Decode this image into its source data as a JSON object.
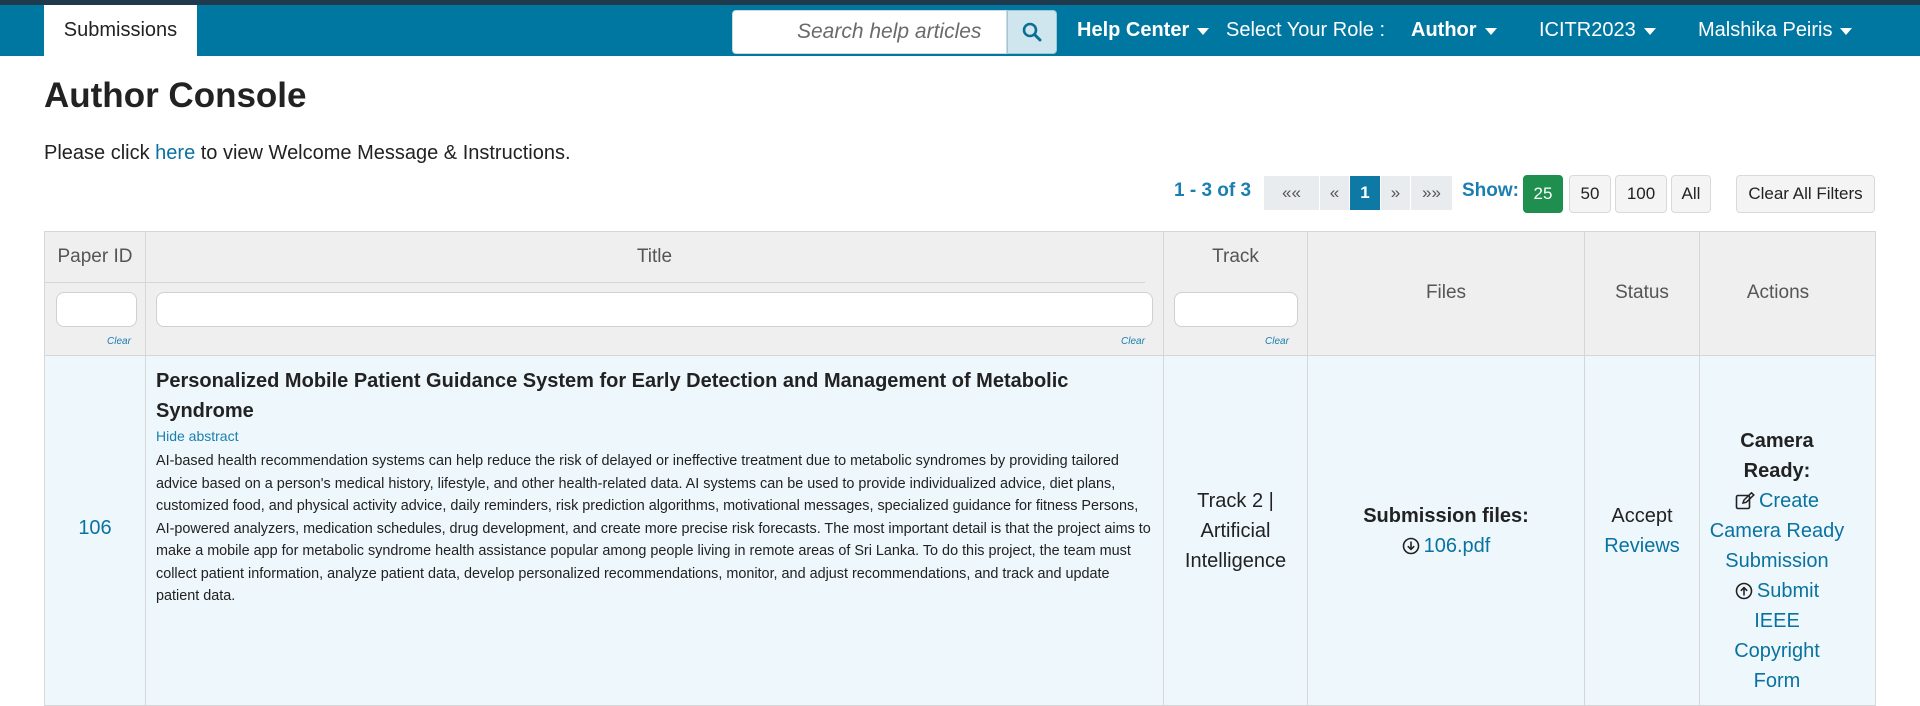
{
  "nav": {
    "tab": "Submissions",
    "search_placeholder": "Search help articles",
    "help_center": "Help Center",
    "role_label": "Select Your Role :",
    "role": "Author",
    "conference": "ICITR2023",
    "user": "Malshika Peiris"
  },
  "page": {
    "title": "Author Console",
    "welcome_prefix": "Please click ",
    "welcome_link": "here",
    "welcome_suffix": " to view Welcome Message & Instructions."
  },
  "pagination": {
    "range": "1 - 3 of 3",
    "first": "««",
    "prev": "«",
    "current": "1",
    "next": "»",
    "last": "»»",
    "show_label": "Show:",
    "sizes": [
      "25",
      "50",
      "100",
      "All"
    ],
    "clear_filters": "Clear All Filters"
  },
  "table": {
    "headers": {
      "paper_id": "Paper ID",
      "title": "Title",
      "track": "Track",
      "files": "Files",
      "status": "Status",
      "actions": "Actions"
    },
    "clear_label": "Clear",
    "row": {
      "paper_id": "106",
      "title": "Personalized Mobile Patient Guidance System for Early Detection and Management of Metabolic Syndrome",
      "hide_abstract": "Hide abstract",
      "abstract": "AI-based health recommendation systems can help reduce the risk of delayed or ineffective treatment due to metabolic syndromes by providing tailored advice based on a person's medical history, lifestyle, and other health-related data. AI systems can be used to provide individualized advice, diet plans, customized food, and physical activity advice, daily reminders, risk prediction algorithms, motivational messages, specialized guidance for fitness Persons, AI-powered analyzers, medication schedules, drug development, and create more precise risk forecasts. The most important detail is that the project aims to make a mobile app for metabolic syndrome health assistance popular among people living in remote areas of Sri Lanka. To do this project, the team must collect patient information, analyze patient data, develop personalized recommendations, monitor, and adjust recommendations, and track and update patient data.",
      "track_line1": "Track 2 |",
      "track_line2": "Artificial",
      "track_line3": "Intelligence",
      "files_label": "Submission files:",
      "file_name": "106.pdf",
      "status": "Accept",
      "reviews": "Reviews",
      "camera_ready_label": "Camera Ready:",
      "create_camera_ready": "Create Camera Ready Submission",
      "submit_copyright": "Submit IEEE Copyright Form"
    }
  },
  "colors": {
    "navbar": "#0077a1",
    "link": "#0a72a0",
    "active_size": "#1e8f4e",
    "row_bg": "#eef7fc"
  }
}
